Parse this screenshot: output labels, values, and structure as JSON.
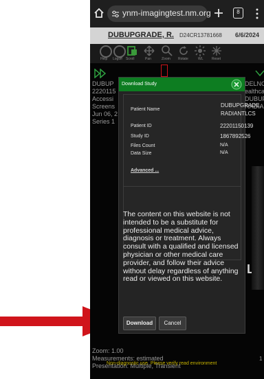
{
  "browser": {
    "url": "ynm-imagingtest.nm.org",
    "tab_count": "8"
  },
  "header": {
    "patient_name": "DUBUPGRADE, R.",
    "accession": "D24CR13781668",
    "date": "6/6/2024"
  },
  "toolbar": {
    "items": [
      {
        "label": "Help",
        "icon": "help-icon"
      },
      {
        "label": "Logoff",
        "icon": "power-icon"
      },
      {
        "label": "Scroll",
        "icon": "scroll-icon"
      },
      {
        "label": "Pan",
        "icon": "pan-icon"
      },
      {
        "label": "Zoom",
        "icon": "zoom-icon"
      },
      {
        "label": "Rotate",
        "icon": "rotate-icon"
      },
      {
        "label": "WL",
        "icon": "window-level-icon"
      },
      {
        "label": "Reset",
        "icon": "reset-icon"
      }
    ]
  },
  "viewer": {
    "left_overlay": [
      "DUBUP",
      "2220115",
      "Accessi",
      "Screens",
      "Jun 06, 2",
      "Series 1"
    ],
    "right_overlay": [
      "DELNO",
      "ealthcar",
      "DUBUPGRAD",
      "RADIANTLCS"
    ],
    "bottom_left": [
      "Zoom: 1.00",
      "Measurements: estimated",
      "Presentation: Multiple, Transient"
    ],
    "warning": "Non-diagnostic use. Please verify read environment",
    "marker": "L",
    "marker2": "1"
  },
  "dialog": {
    "title": "Download Study",
    "fields": [
      {
        "label": "Patient Name",
        "value": "DUBUPGRADE, RADIANTLCS"
      },
      {
        "label": "Patient ID",
        "value": "22201150139"
      },
      {
        "label": "Study ID",
        "value": "1867892526"
      },
      {
        "label": "Files Count",
        "value": "N/A"
      },
      {
        "label": "Data Size",
        "value": "N/A"
      }
    ],
    "advanced_link": "Advanced ...",
    "disclaimer": "The content on this website is not intended to be a substitute for professional medical advice, diagnosis or treatment. Always consult with a qualified and licensed physician or other medical care provider, and follow their advice without delay regardless of anything read or viewed on this website.",
    "download_label": "Download",
    "cancel_label": "Cancel"
  },
  "colors": {
    "accent_green": "#0d7d21",
    "arrow_red": "#d0141b",
    "dialog_bg": "#242424"
  }
}
